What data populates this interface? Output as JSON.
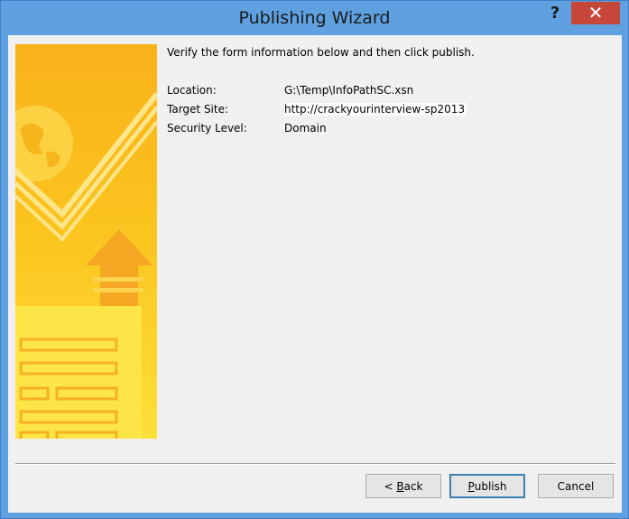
{
  "window": {
    "title": "Publishing Wizard",
    "help_glyph": "?",
    "close_glyph": "✕"
  },
  "content": {
    "intro": "Verify the form information below and then click publish.",
    "fields": [
      {
        "label": "Location:",
        "value": "G:\\Temp\\InfoPathSC.xsn"
      },
      {
        "label": "Target Site:",
        "value": "http://crackyourinterview-sp2013"
      },
      {
        "label": "Security Level:",
        "value": "Domain"
      }
    ]
  },
  "buttons": {
    "back_prefix": "< ",
    "back_access": "B",
    "back_rest": "ack",
    "publish_access": "P",
    "publish_rest": "ublish",
    "cancel": "Cancel"
  },
  "colors": {
    "titlebar": "#5fa1e0",
    "close": "#c7463a",
    "banner": "#fbc21a"
  }
}
